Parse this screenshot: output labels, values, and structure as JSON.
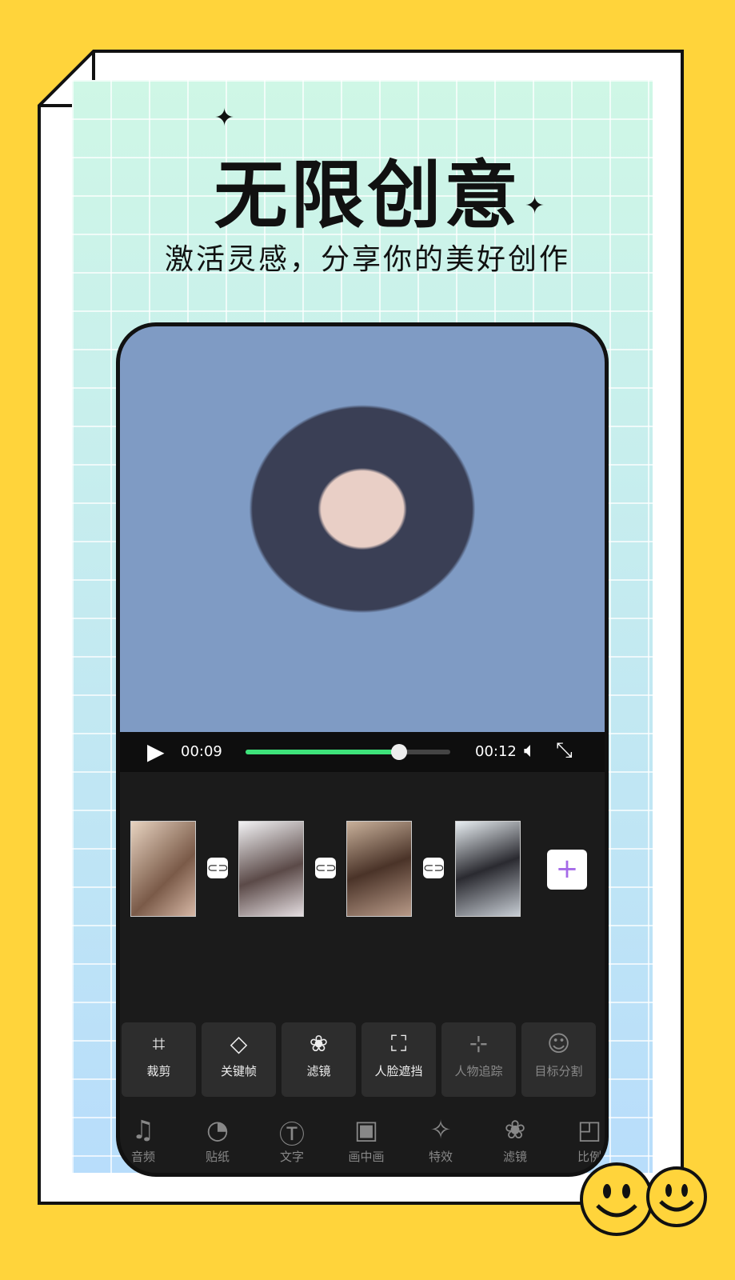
{
  "headline": "无限创意",
  "subheadline": "激活灵感，分享你的美好创作",
  "player": {
    "current_time": "00:09",
    "total_time": "00:12",
    "progress_percent": 75,
    "accent": "#3ee27a"
  },
  "timeline": {
    "clip_count": 4,
    "add_label": "+"
  },
  "tools": [
    {
      "label": "裁剪",
      "icon": "crop-icon",
      "g": "⌗"
    },
    {
      "label": "关键帧",
      "icon": "keyframe-icon",
      "g": "◇"
    },
    {
      "label": "滤镜",
      "icon": "filter-icon",
      "g": "❀"
    },
    {
      "label": "人脸遮挡",
      "icon": "face-mask-icon",
      "g": "⛶"
    },
    {
      "label": "人物追踪",
      "icon": "tracking-icon",
      "g": "⊹"
    },
    {
      "label": "目标分割",
      "icon": "segment-icon",
      "g": "☺"
    }
  ],
  "nav": [
    {
      "label": "音频",
      "icon": "music-icon",
      "g": "♫"
    },
    {
      "label": "贴纸",
      "icon": "sticker-icon",
      "g": "◔"
    },
    {
      "label": "文字",
      "icon": "text-icon",
      "g": "Ⓣ"
    },
    {
      "label": "画中画",
      "icon": "pip-icon",
      "g": "▣"
    },
    {
      "label": "特效",
      "icon": "effects-icon",
      "g": "✧"
    },
    {
      "label": "滤镜",
      "icon": "filter-icon",
      "g": "❀"
    },
    {
      "label": "比例",
      "icon": "ratio-icon",
      "g": "◰"
    }
  ]
}
